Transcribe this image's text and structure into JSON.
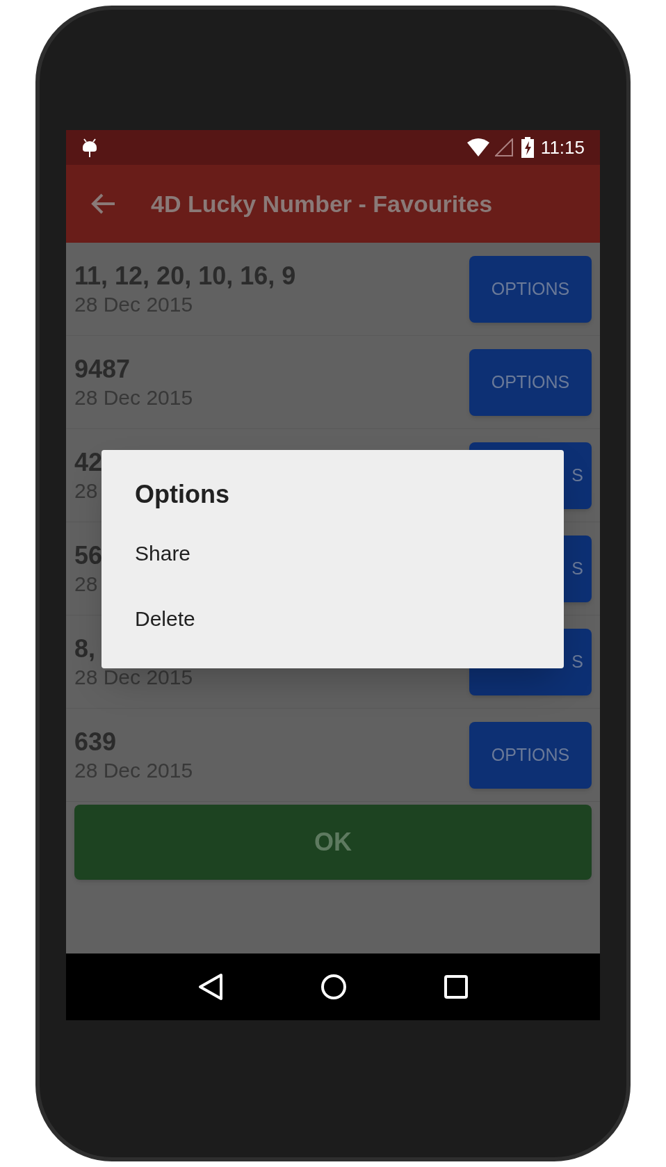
{
  "status_bar": {
    "time": "11:15"
  },
  "app_bar": {
    "title": "4D Lucky Number - Favourites"
  },
  "favourites": [
    {
      "numbers": "11, 12, 20, 10, 16, 9",
      "date": "28 Dec 2015",
      "button": "OPTIONS"
    },
    {
      "numbers": "9487",
      "date": "28 Dec 2015",
      "button": "OPTIONS"
    },
    {
      "numbers": "42",
      "date": "28",
      "button": "S"
    },
    {
      "numbers": "56",
      "date": "28",
      "button": "S"
    },
    {
      "numbers": "8,",
      "date": "28 Dec 2015",
      "button": "S"
    },
    {
      "numbers": "639",
      "date": "28 Dec 2015",
      "button": "OPTIONS"
    }
  ],
  "ok_button": "OK",
  "dialog": {
    "title": "Options",
    "items": [
      "Share",
      "Delete"
    ]
  }
}
